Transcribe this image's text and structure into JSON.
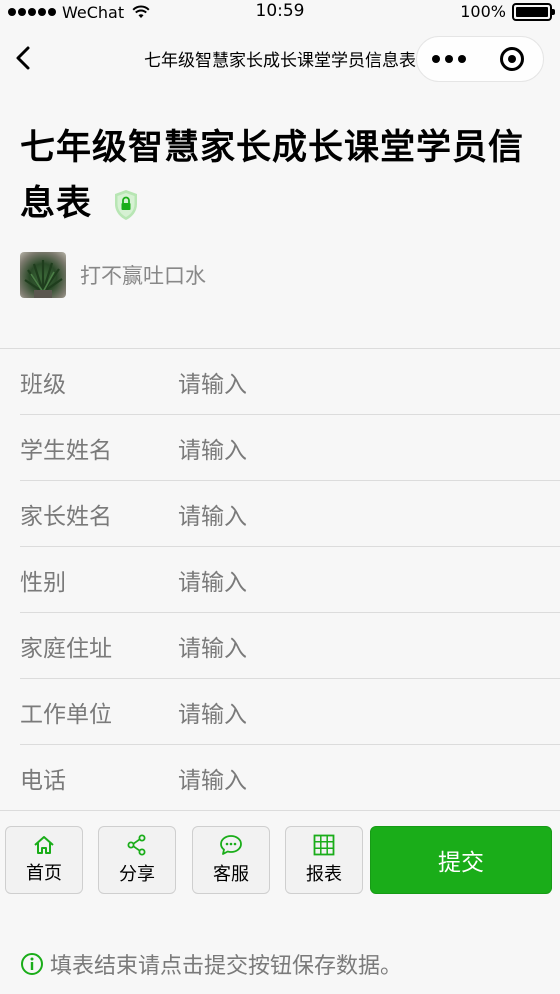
{
  "status_bar": {
    "carrier": "WeChat",
    "time": "10:59",
    "battery": "100%",
    "battery_level": 1.0
  },
  "nav": {
    "title": "七年级智慧家长成长课堂学员信息表"
  },
  "form": {
    "title": "七年级智慧家长成长课堂学员信息表",
    "author": "打不赢吐口水"
  },
  "fields": [
    {
      "label": "班级",
      "placeholder": "请输入"
    },
    {
      "label": "学生姓名",
      "placeholder": "请输入"
    },
    {
      "label": "家长姓名",
      "placeholder": "请输入"
    },
    {
      "label": "性别",
      "placeholder": "请输入"
    },
    {
      "label": "家庭住址",
      "placeholder": "请输入"
    },
    {
      "label": "工作单位",
      "placeholder": "请输入"
    },
    {
      "label": "电话",
      "placeholder": "请输入"
    }
  ],
  "toolbar": {
    "home_label": "首页",
    "share_label": "分享",
    "service_label": "客服",
    "report_label": "报表",
    "submit_label": "提交"
  },
  "notice": {
    "text": "填表结束请点击提交按钮保存数据。"
  },
  "colors": {
    "accent": "#1aad19",
    "background": "#f7f7f7",
    "muted_text": "#7a7a7a"
  },
  "icons": {
    "home": "home-icon",
    "share": "share-icon",
    "service": "chat-icon",
    "report": "table-icon",
    "notice": "info-icon",
    "verified": "shield-lock-icon"
  }
}
